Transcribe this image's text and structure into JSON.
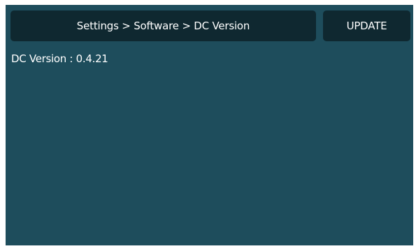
{
  "header": {
    "breadcrumb": "Settings > Software > DC Version",
    "update_label": "UPDATE"
  },
  "content": {
    "version_text": "DC Version : 0.4.21"
  },
  "colors": {
    "screen_background": "#1e4d5c",
    "bar_background": "#0f2830",
    "text": "#ffffff"
  }
}
